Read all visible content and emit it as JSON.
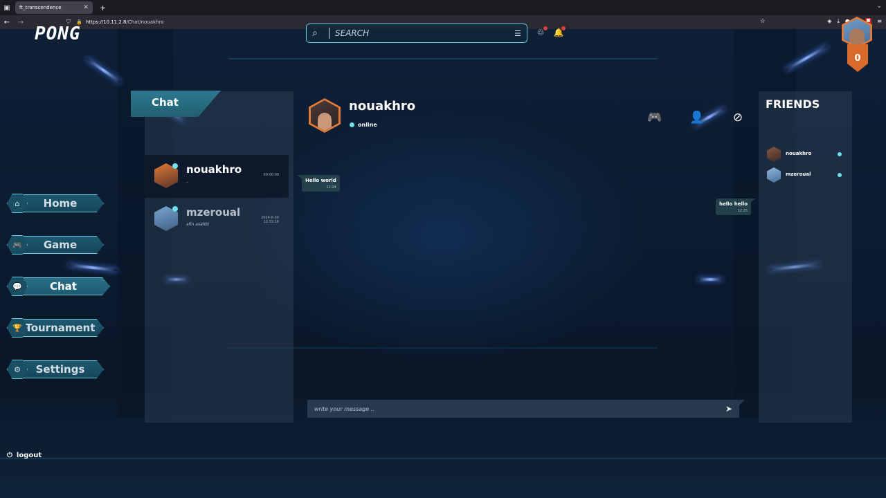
{
  "browser": {
    "tab_title": "ft_transcendence",
    "url_host": "https://10.11.2.8",
    "url_path": "/Chat/nouakhro"
  },
  "app": {
    "logo": "PONG",
    "search_placeholder": "SEARCH",
    "level": "0"
  },
  "nav": {
    "home": "Home",
    "game": "Game",
    "chat": "Chat",
    "tournament": "Tournament",
    "settings": "Settings",
    "logout": "logout",
    "active": "chat"
  },
  "chat_list": {
    "title": "Chat",
    "conversations": [
      {
        "name": "nouakhro",
        "preview": "..",
        "time": "00:00:00",
        "selected": true
      },
      {
        "name": "mzeroual",
        "preview": "afin asahbi",
        "time": "2024-0-30 12:33:16",
        "selected": false
      }
    ]
  },
  "conversation": {
    "peer_name": "nouakhro",
    "peer_status": "online",
    "messages": [
      {
        "text": "Hello world",
        "time": "12:24",
        "direction": "in"
      },
      {
        "text": "hello hello",
        "time": "12:25",
        "direction": "out"
      }
    ],
    "composer_placeholder": "write your message .."
  },
  "friends": {
    "title": "FRIENDS",
    "items": [
      {
        "name": "nouakhro",
        "status": "online"
      },
      {
        "name": "mzeroual",
        "status": "online"
      }
    ]
  },
  "colors": {
    "accent_cyan": "#6fe0e8",
    "avatar_border": "#e07b39",
    "panel_teal": "#21606f",
    "notify_red": "#e03c3c"
  }
}
